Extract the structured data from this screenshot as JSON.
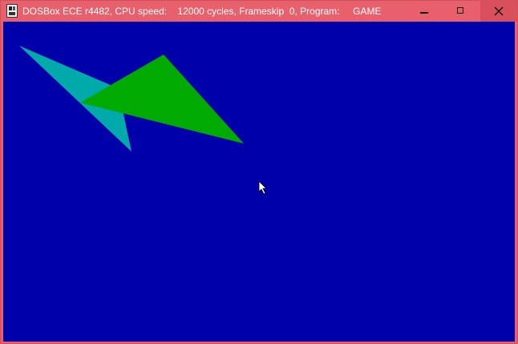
{
  "window": {
    "title": "DOSBox ECE r4482, CPU speed:    12000 cycles, Frameskip  0, Program:     GAME",
    "icon": "dosbox-app-icon",
    "controls": {
      "minimize_icon": "minimize-icon",
      "maximize_icon": "maximize-icon",
      "close_icon": "close-icon"
    }
  },
  "colors": {
    "titlebar": "#e8606b",
    "screen_background": "#0000aa",
    "cyan_shape": "#00aaaa",
    "green_shape": "#00aa00",
    "cursor": "#ffffff"
  },
  "screen": {
    "shapes": [
      {
        "name": "cyan-triangle",
        "color": "cyan"
      },
      {
        "name": "green-triangle",
        "color": "green"
      }
    ],
    "cursor_icon": "mouse-pointer-icon"
  }
}
